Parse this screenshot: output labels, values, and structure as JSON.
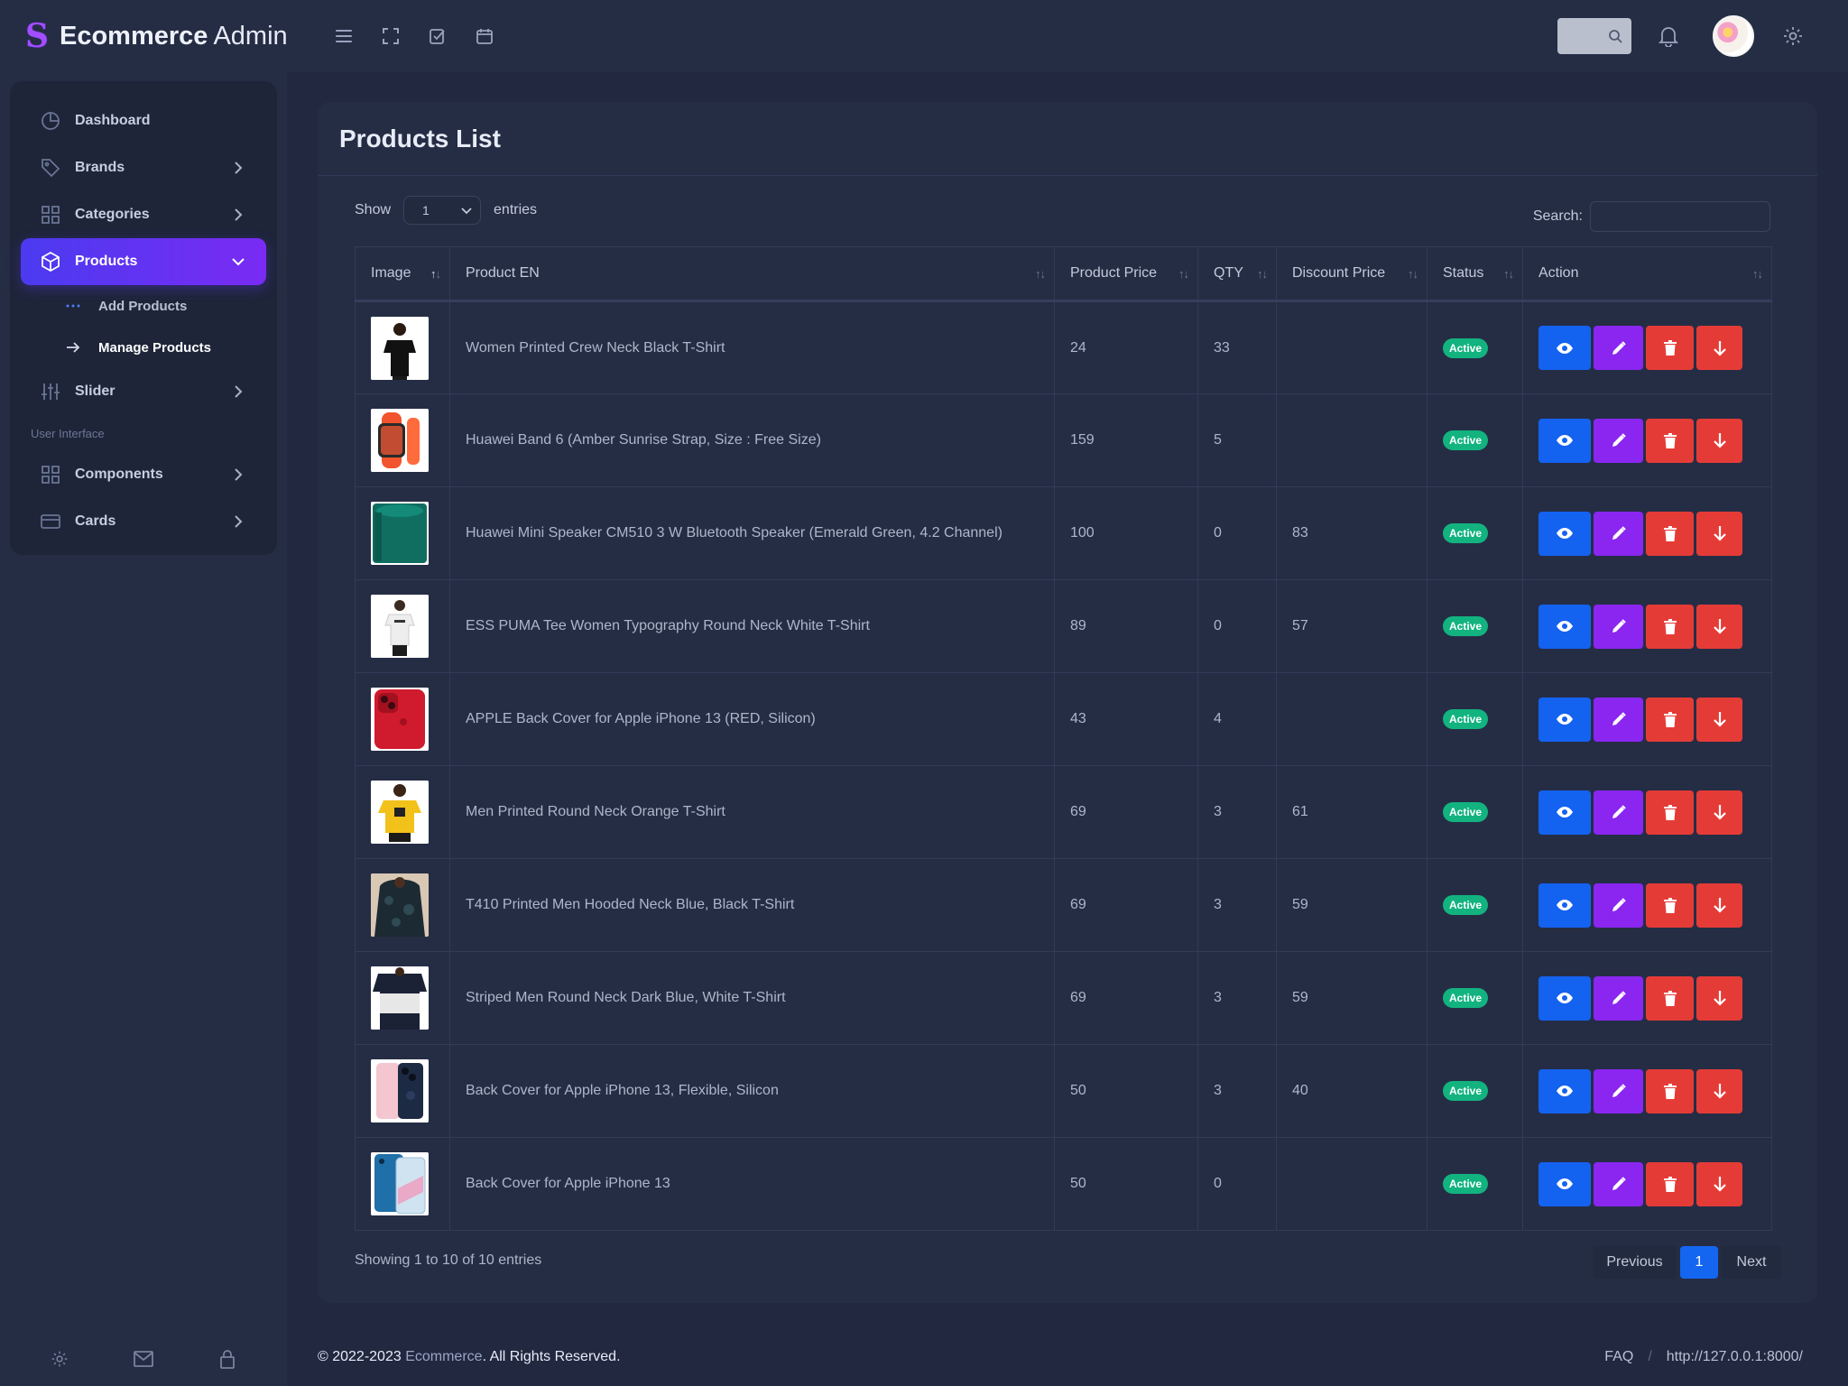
{
  "brand": {
    "name_bold": "Ecommerce",
    "name_light": "Admin"
  },
  "header": {
    "icons": [
      "menu-icon",
      "fullscreen-icon",
      "task-icon",
      "calendar-icon"
    ]
  },
  "sidebar": {
    "items": [
      {
        "label": "Dashboard"
      },
      {
        "label": "Brands"
      },
      {
        "label": "Categories"
      },
      {
        "label": "Products"
      },
      {
        "label": "Slider"
      },
      {
        "label": "Components"
      },
      {
        "label": "Cards"
      }
    ],
    "sub_items": [
      {
        "label": "Add Products"
      },
      {
        "label": "Manage Products"
      }
    ],
    "section_label": "User Interface"
  },
  "page": {
    "title": "Products List",
    "show_label": "Show",
    "show_value": "1",
    "entries_label": "entries",
    "search_label": "Search:"
  },
  "table": {
    "columns": [
      "Image",
      "Product EN",
      "Product Price",
      "QTY",
      "Discount Price",
      "Status",
      "Action"
    ],
    "rows": [
      {
        "name": "Women Printed Crew Neck Black T-Shirt",
        "price": "24",
        "qty": "33",
        "discount": "",
        "status": "Active"
      },
      {
        "name": "Huawei Band 6 (Amber Sunrise Strap, Size : Free Size)",
        "price": "159",
        "qty": "5",
        "discount": "",
        "status": "Active"
      },
      {
        "name": "Huawei Mini Speaker CM510 3 W Bluetooth Speaker (Emerald Green, 4.2 Channel)",
        "price": "100",
        "qty": "0",
        "discount": "83",
        "status": "Active"
      },
      {
        "name": "ESS PUMA Tee Women Typography Round Neck White T-Shirt",
        "price": "89",
        "qty": "0",
        "discount": "57",
        "status": "Active"
      },
      {
        "name": "APPLE Back Cover for Apple iPhone 13 (RED, Silicon)",
        "price": "43",
        "qty": "4",
        "discount": "",
        "status": "Active"
      },
      {
        "name": "Men Printed Round Neck Orange T-Shirt",
        "price": "69",
        "qty": "3",
        "discount": "61",
        "status": "Active"
      },
      {
        "name": "T410 Printed Men Hooded Neck Blue, Black T-Shirt",
        "price": "69",
        "qty": "3",
        "discount": "59",
        "status": "Active"
      },
      {
        "name": "Striped Men Round Neck Dark Blue, White T-Shirt",
        "price": "69",
        "qty": "3",
        "discount": "59",
        "status": "Active"
      },
      {
        "name": "Back Cover for Apple iPhone 13, Flexible, Silicon",
        "price": "50",
        "qty": "3",
        "discount": "40",
        "status": "Active"
      },
      {
        "name": "Back Cover for Apple iPhone 13",
        "price": "50",
        "qty": "0",
        "discount": "",
        "status": "Active"
      }
    ]
  },
  "pagination": {
    "info": "Showing 1 to 10 of 10 entries",
    "previous": "Previous",
    "current": "1",
    "next": "Next"
  },
  "footer": {
    "copyright_prefix": "© 2022-2023",
    "brand_link": "Ecommerce",
    "copyright_suffix": ". All Rights Reserved.",
    "faq": "FAQ",
    "separator": "/",
    "url": "http://127.0.0.1:8000/"
  },
  "colors": {
    "accent_gradient_start": "#4b3bf0",
    "accent_gradient_end": "#7a2bf3",
    "view_button": "#1462f0",
    "edit_button": "#8a26f0",
    "delete_button": "#e53b37",
    "status_active": "#12b37f"
  }
}
